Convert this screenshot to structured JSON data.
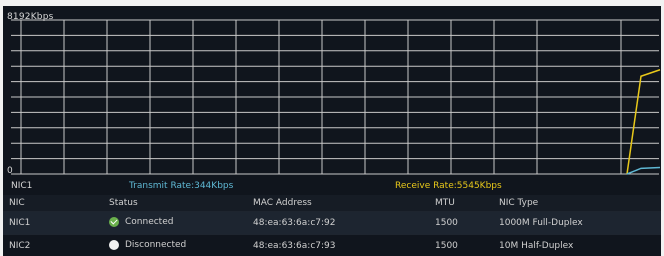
{
  "chart": {
    "y_max_label": "8192Kbps",
    "y_min_label": "0",
    "y_max_value": 8192,
    "grid": true,
    "grid_color": "#c9c9c9",
    "background": "#10151d"
  },
  "chart_data": {
    "type": "line",
    "ylim": [
      0,
      8192
    ],
    "series": [
      {
        "name": "Receive Rate",
        "color": "#e8c81a",
        "values": [
          0,
          0,
          0,
          0,
          0,
          0,
          0,
          0,
          0,
          0,
          0,
          0,
          0,
          0,
          0,
          0,
          0,
          0,
          0,
          0,
          0,
          0,
          0,
          0,
          5200,
          5545
        ]
      },
      {
        "name": "Transmit Rate",
        "color": "#5fb8d4",
        "values": [
          0,
          0,
          0,
          0,
          0,
          0,
          0,
          0,
          0,
          0,
          0,
          0,
          0,
          0,
          0,
          0,
          0,
          0,
          0,
          0,
          0,
          0,
          0,
          0,
          300,
          344
        ]
      }
    ]
  },
  "rate_bar": {
    "nic": "NIC1",
    "transmit": "Transmit Rate:344Kbps",
    "receive": "Receive Rate:5545Kbps",
    "transmit_color": "#5fb8d4",
    "receive_color": "#e8c81a"
  },
  "table": {
    "headers": [
      "NIC",
      "Status",
      "MAC Address",
      "MTU",
      "NIC Type"
    ],
    "rows": [
      {
        "nic": "NIC1",
        "status": "Connected",
        "status_icon": "check-circle-icon",
        "mac": "48:ea:63:6a:c7:92",
        "mtu": "1500",
        "type": "1000M Full-Duplex"
      },
      {
        "nic": "NIC2",
        "status": "Disconnected",
        "status_icon": "empty-circle-icon",
        "mac": "48:ea:63:6a:c7:93",
        "mtu": "1500",
        "type": "10M Half-Duplex"
      }
    ]
  }
}
